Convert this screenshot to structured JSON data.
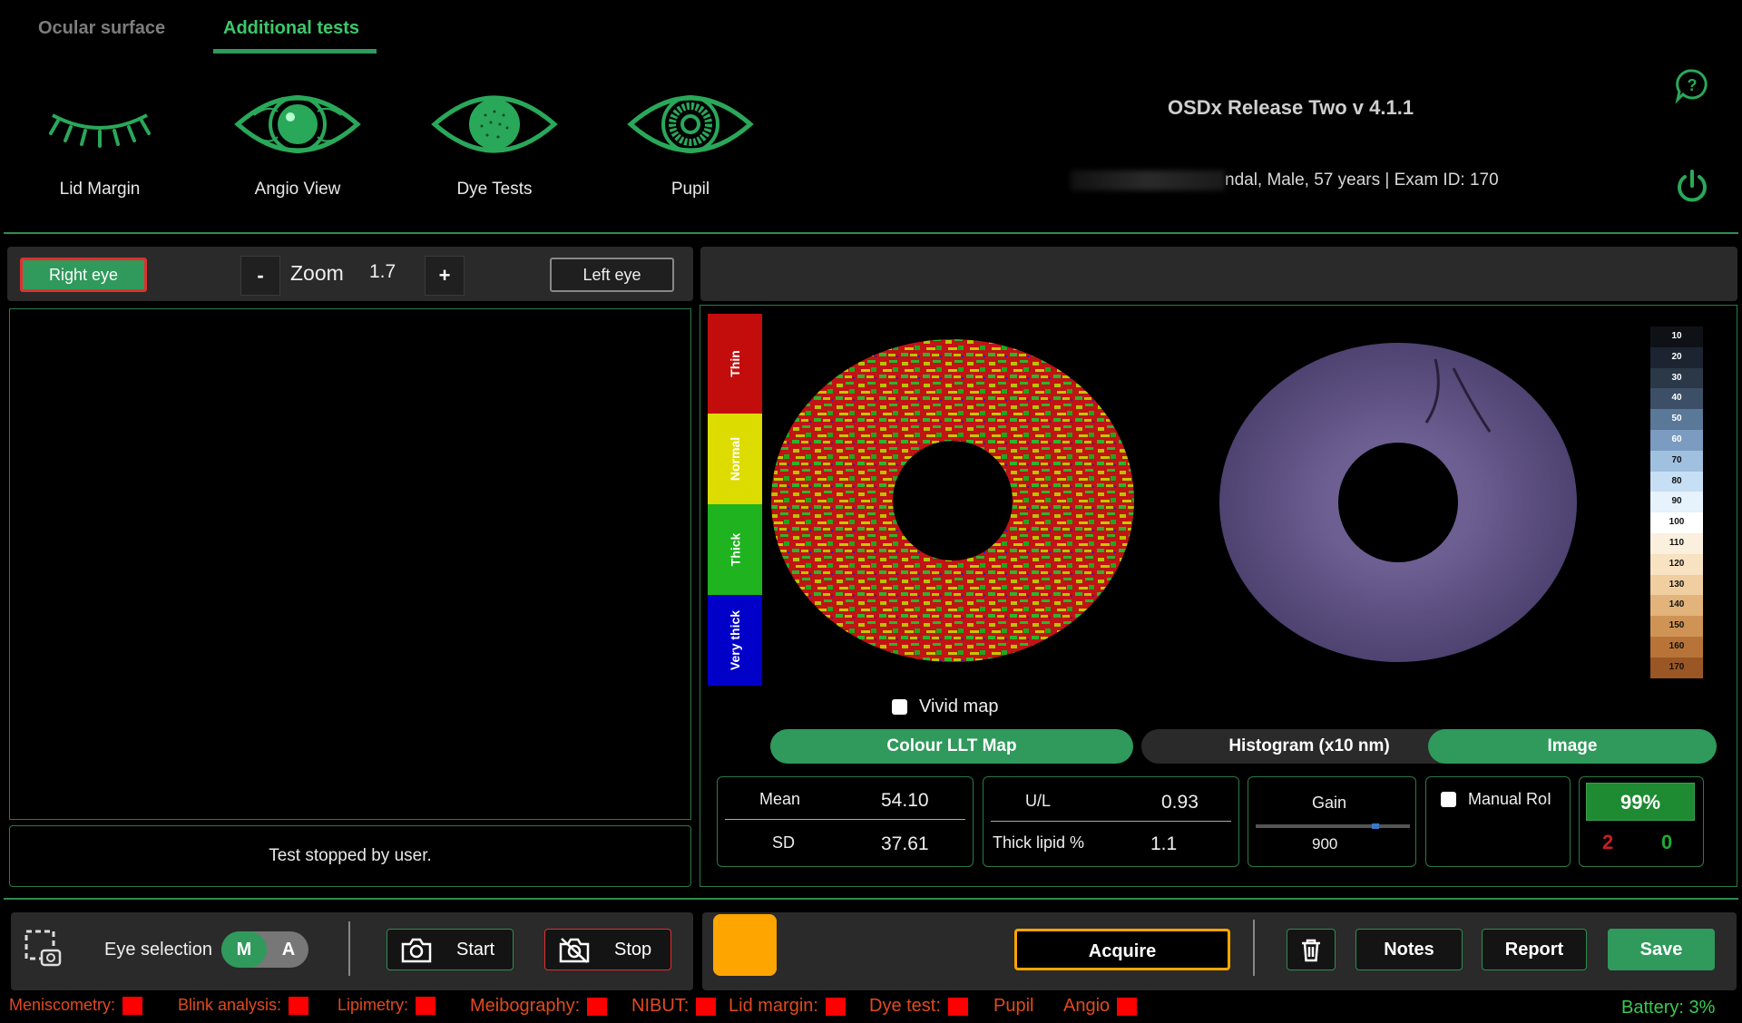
{
  "tabs": [
    {
      "label": "Ocular surface",
      "active": false
    },
    {
      "label": "Additional tests",
      "active": true
    }
  ],
  "tools": [
    {
      "label": "Lid Margin",
      "icon": "eyelashes-icon"
    },
    {
      "label": "Angio View",
      "icon": "eye-vessels-icon"
    },
    {
      "label": "Dye Tests",
      "icon": "eye-dotted-icon"
    },
    {
      "label": "Pupil",
      "icon": "eye-pupil-icon"
    }
  ],
  "header": {
    "app_title": "OSDx Release Two v 4.1.1",
    "patient_info": "ndal, Male, 57 years  |  Exam ID: 170"
  },
  "left_panel": {
    "right_eye_label": "Right eye",
    "zoom_minus": "-",
    "zoom_label": "Zoom",
    "zoom_value": "1.7",
    "zoom_plus": "+",
    "left_eye_label": "Left eye",
    "status_message": "Test stopped by user."
  },
  "thickness_scale": [
    "Thin",
    "Normal",
    "Thick",
    "Very thick"
  ],
  "colors": {
    "accent": "#2f9a5b",
    "thin": "#c30d0d",
    "normal": "#dcdc00",
    "thick": "#1fb31f",
    "very_thick": "#0000c8",
    "warning": "#ffa500"
  },
  "right_panel": {
    "vivid_map_label": "Vivid map",
    "vivid_map_checked": false,
    "view_tabs": [
      "Colour LLT Map",
      "Histogram (x10 nm)",
      "Image"
    ],
    "color_scale_labels": [
      "10",
      "20",
      "30",
      "40",
      "50",
      "60",
      "70",
      "80",
      "90",
      "100",
      "110",
      "120",
      "130",
      "140",
      "150",
      "160",
      "170"
    ],
    "stats": {
      "mean_label": "Mean",
      "mean_value": "54.10",
      "sd_label": "SD",
      "sd_value": "37.61",
      "ul_label": "U/L",
      "ul_value": "0.93",
      "thick_lipid_label": "Thick lipid %",
      "thick_lipid_value": "1.1",
      "gain_label": "Gain",
      "gain_value": "900",
      "manual_roi_label": "Manual RoI",
      "percent": "99%",
      "count_red": "2",
      "count_green": "0"
    }
  },
  "bottom_bar": {
    "eye_selection_label": "Eye selection",
    "toggle_m": "M",
    "toggle_a": "A",
    "start_label": "Start",
    "stop_label": "Stop",
    "acquire_label": "Acquire",
    "notes_label": "Notes",
    "report_label": "Report",
    "save_label": "Save"
  },
  "status_legend": [
    "Meniscometry:",
    "Blink analysis:",
    "Lipimetry:",
    "Meibography:",
    "NIBUT:",
    "Lid margin:",
    "Dye test:",
    "Pupil",
    "Angio"
  ],
  "battery": "Battery: 3%"
}
